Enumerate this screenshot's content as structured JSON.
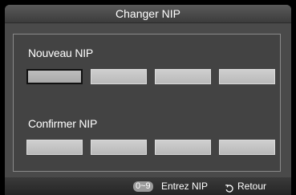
{
  "dialog": {
    "title": "Changer NIP"
  },
  "new_pin": {
    "label": "Nouveau NIP",
    "digits": [
      "",
      "",
      "",
      ""
    ],
    "active_index": 0
  },
  "confirm_pin": {
    "label": "Confirmer NIP",
    "digits": [
      "",
      "",
      "",
      ""
    ]
  },
  "footer": {
    "key_range": "0~9",
    "enter_label": "Entrez NIP",
    "return_icon": "return-icon",
    "return_label": "Retour"
  },
  "colors": {
    "background": "#000000",
    "osd": "#4a4a4a",
    "field": "#c4c4c4",
    "active_border": "#111111",
    "text": "#ffffff"
  }
}
